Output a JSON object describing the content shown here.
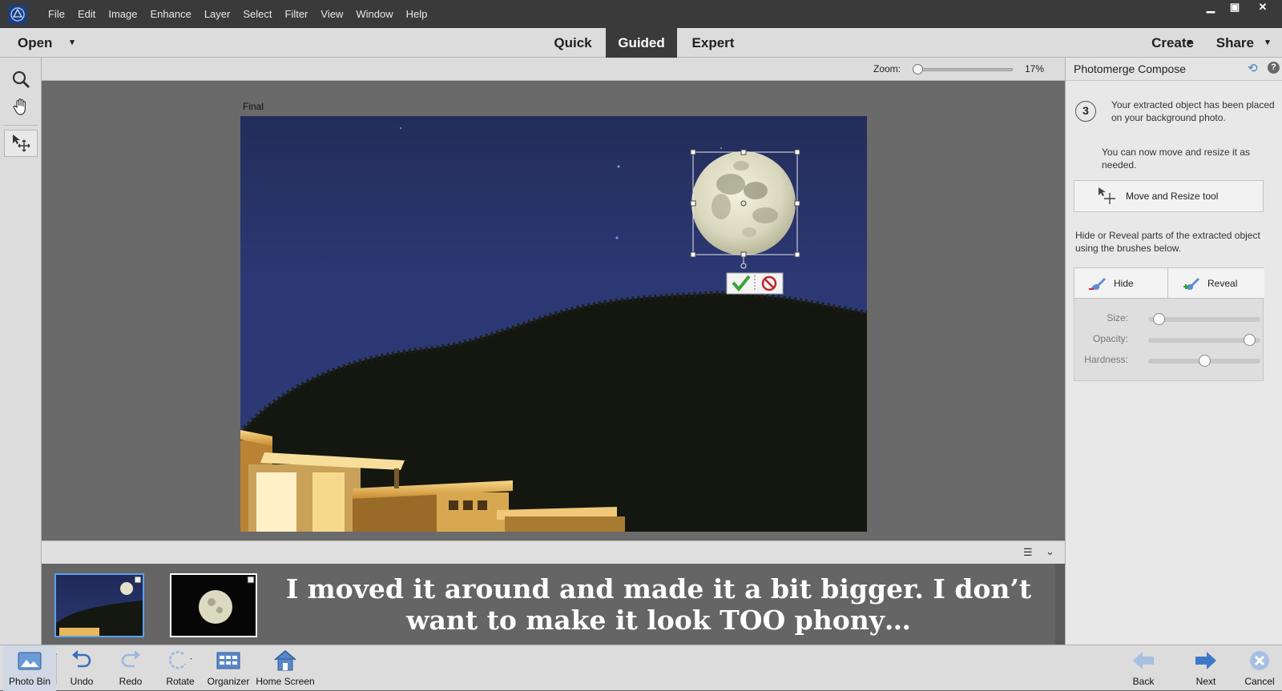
{
  "menubar": {
    "items": [
      "File",
      "Edit",
      "Image",
      "Enhance",
      "Layer",
      "Select",
      "Filter",
      "View",
      "Window",
      "Help"
    ],
    "window_controls": {
      "minimize": "▁",
      "restore": "▣",
      "close": "✕"
    }
  },
  "modebar": {
    "open_label": "Open",
    "tabs": [
      "Quick",
      "Guided",
      "Expert"
    ],
    "active_tab": "Guided",
    "create_label": "Create",
    "share_label": "Share"
  },
  "zoom": {
    "label": "Zoom:",
    "value_text": "17%",
    "level": 0.0
  },
  "canvas": {
    "doc_label": "Final"
  },
  "panel": {
    "title": "Photomerge Compose",
    "step_number": "3",
    "step_text": "Your extracted object has been placed on your background photo.",
    "step_text2": "You can now move and resize it as needed.",
    "move_button": "Move and Resize tool",
    "hide_reveal_text": "Hide or Reveal parts of the extracted object using the brushes below.",
    "hide_button": "Hide",
    "reveal_button": "Reveal",
    "sliders": [
      {
        "label": "Size:",
        "level": 0.05
      },
      {
        "label": "Opacity:",
        "level": 0.95
      },
      {
        "label": "Hardness:",
        "level": 0.5
      }
    ]
  },
  "photobin": {
    "caption": "I moved it around and made it a bit bigger. I don’t want to make it look TOO phony…"
  },
  "taskbar": {
    "left": [
      "Photo Bin",
      "Undo",
      "Redo",
      "Rotate",
      "Organizer",
      "Home Screen"
    ],
    "right": [
      "Back",
      "Next",
      "Cancel"
    ]
  },
  "colors": {
    "accent_active_tab": "#3a3a3a",
    "selection_blue": "#4a8ad8"
  }
}
